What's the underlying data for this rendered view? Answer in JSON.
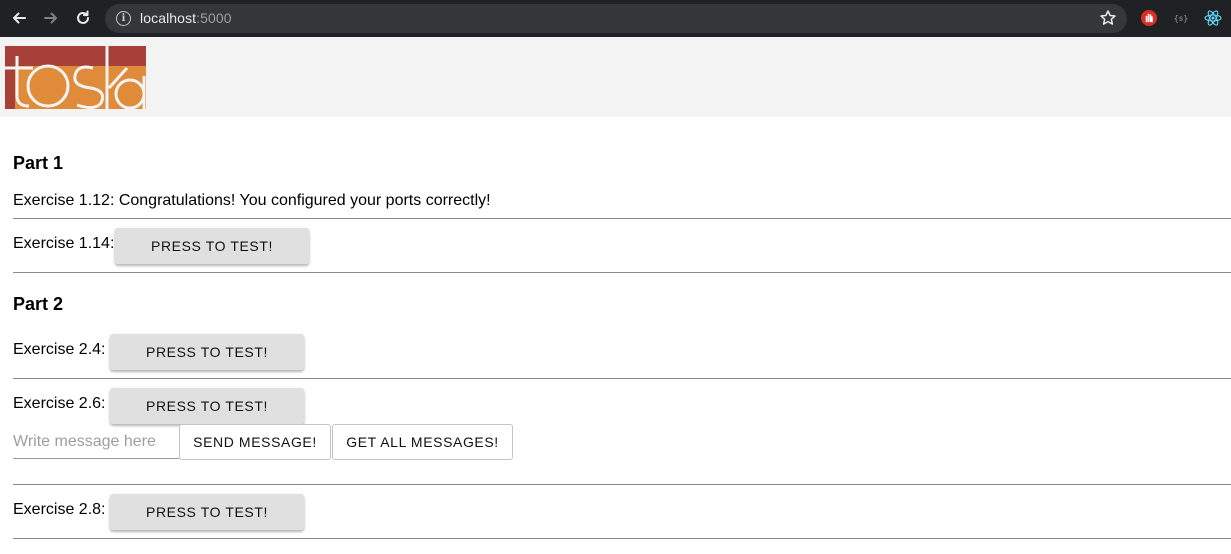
{
  "browser": {
    "url_host": "localhost",
    "url_port": ":5000"
  },
  "header": {
    "logo_text": "toska",
    "colors": {
      "brand_red": "#a8403a",
      "brand_orange": "#e08b3a"
    }
  },
  "part1": {
    "title": "Part 1",
    "ex112_text": "Exercise 1.12: Congratulations! You configured your ports correctly!",
    "ex114_label": "Exercise 1.14:",
    "ex114_button": "PRESS TO TEST!"
  },
  "part2": {
    "title": "Part 2",
    "ex24_label": "Exercise 2.4:",
    "ex24_button": "PRESS TO TEST!",
    "ex26_label": "Exercise 2.6:",
    "ex26_button": "PRESS TO TEST!",
    "message_placeholder": "Write message here",
    "send_button": "SEND MESSAGE!",
    "get_all_button": "GET ALL MESSAGES!",
    "ex28_label": "Exercise 2.8:",
    "ex28_button": "PRESS TO TEST!"
  }
}
